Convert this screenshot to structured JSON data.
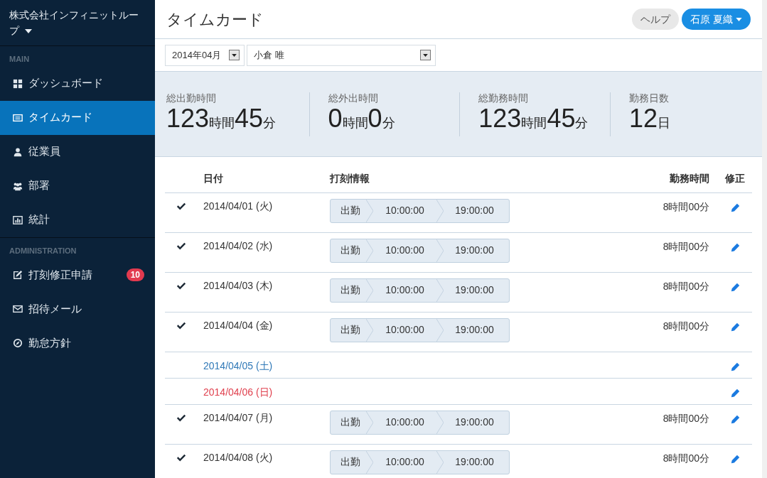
{
  "sidebar": {
    "company": "株式会社インフィニットループ",
    "sections": [
      {
        "heading": "MAIN",
        "items": [
          {
            "label": "ダッシュボード",
            "selected": false
          },
          {
            "label": "タイムカード",
            "selected": true
          },
          {
            "label": "従業員",
            "selected": false
          },
          {
            "label": "部署",
            "selected": false
          },
          {
            "label": "統計",
            "selected": false
          }
        ]
      },
      {
        "heading": "ADMINISTRATION",
        "items": [
          {
            "label": "打刻修正申請",
            "selected": false,
            "badge": "10"
          },
          {
            "label": "招待メール",
            "selected": false
          },
          {
            "label": "勤怠方針",
            "selected": false
          }
        ]
      }
    ]
  },
  "header": {
    "title": "タイムカード",
    "help": "ヘルプ",
    "user": "石原 夏織"
  },
  "filters": {
    "month": "2014年04月",
    "employee": "小倉 唯"
  },
  "stats": [
    {
      "label": "総出勤時間",
      "parts": [
        {
          "kind": "number",
          "text": "123"
        },
        {
          "kind": "unit",
          "text": "時間"
        },
        {
          "kind": "number",
          "text": "45"
        },
        {
          "kind": "unit",
          "text": "分"
        }
      ]
    },
    {
      "label": "総外出時間",
      "parts": [
        {
          "kind": "number",
          "text": "0"
        },
        {
          "kind": "unit",
          "text": "時間"
        },
        {
          "kind": "number",
          "text": "0"
        },
        {
          "kind": "unit",
          "text": "分"
        }
      ]
    },
    {
      "label": "総勤務時間",
      "parts": [
        {
          "kind": "number",
          "text": "123"
        },
        {
          "kind": "unit",
          "text": "時間"
        },
        {
          "kind": "number",
          "text": "45"
        },
        {
          "kind": "unit",
          "text": "分"
        }
      ]
    },
    {
      "label": "勤務日数",
      "parts": [
        {
          "kind": "number",
          "text": "12"
        },
        {
          "kind": "unit",
          "text": "日"
        }
      ]
    }
  ],
  "table": {
    "columns": [
      "日付",
      "打刻情報",
      "勤務時間",
      "修正"
    ],
    "rows": [
      {
        "kind": "weekday",
        "checked": true,
        "date": "2014/04/01 (火)",
        "punches": [
          "出勤",
          "10:00:00",
          "19:00:00"
        ],
        "hours": "8時間00分"
      },
      {
        "kind": "weekday",
        "checked": true,
        "date": "2014/04/02 (水)",
        "punches": [
          "出勤",
          "10:00:00",
          "19:00:00"
        ],
        "hours": "8時間00分"
      },
      {
        "kind": "weekday",
        "checked": true,
        "date": "2014/04/03 (木)",
        "punches": [
          "出勤",
          "10:00:00",
          "19:00:00"
        ],
        "hours": "8時間00分"
      },
      {
        "kind": "weekday",
        "checked": true,
        "date": "2014/04/04 (金)",
        "punches": [
          "出勤",
          "10:00:00",
          "19:00:00"
        ],
        "hours": "8時間00分"
      },
      {
        "kind": "saturday",
        "checked": false,
        "date": "2014/04/05 (土)"
      },
      {
        "kind": "sunday",
        "checked": false,
        "date": "2014/04/06 (日)"
      },
      {
        "kind": "weekday",
        "checked": true,
        "date": "2014/04/07 (月)",
        "punches": [
          "出勤",
          "10:00:00",
          "19:00:00"
        ],
        "hours": "8時間00分"
      },
      {
        "kind": "weekday",
        "checked": true,
        "date": "2014/04/08 (火)",
        "punches": [
          "出勤",
          "10:00:00",
          "19:00:00"
        ],
        "hours": "8時間00分"
      }
    ]
  }
}
